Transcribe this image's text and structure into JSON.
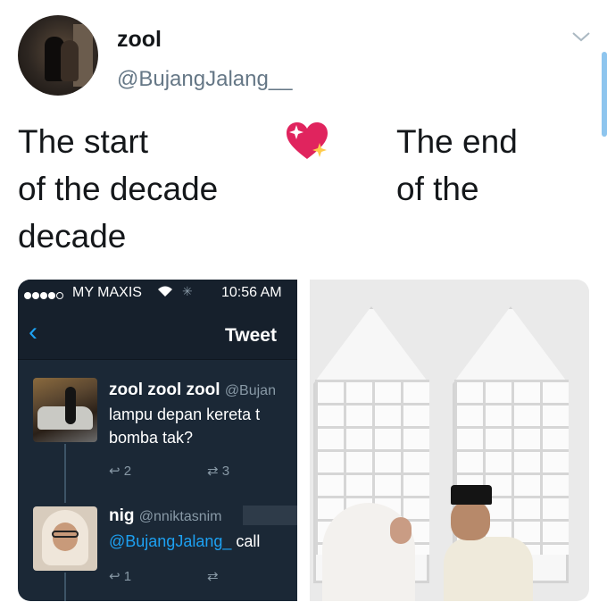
{
  "author": {
    "display_name": "zool",
    "handle": "@BujangJalang__"
  },
  "tweet": {
    "left_text": "The start\nof the decade\ndecade",
    "right_text": "The end\nof the",
    "emoji": "sparkling-heart"
  },
  "screenshot": {
    "carrier": "MY MAXIS",
    "time": "10:56 AM",
    "nav_title": "Tweet",
    "tweet1": {
      "name": "zool zool zool",
      "handle": "@Bujan",
      "line1": "lampu depan kereta t",
      "line2": "bomba tak?",
      "replies": "2",
      "retweets": "3"
    },
    "tweet2": {
      "name": "nig",
      "handle": "@nniktasnim",
      "mention": "@BujangJalang_",
      "text_after": " call",
      "replies": "1"
    }
  },
  "colors": {
    "accent": "#1da1f2",
    "dark_bg": "#1b2836",
    "muted": "#657786"
  }
}
